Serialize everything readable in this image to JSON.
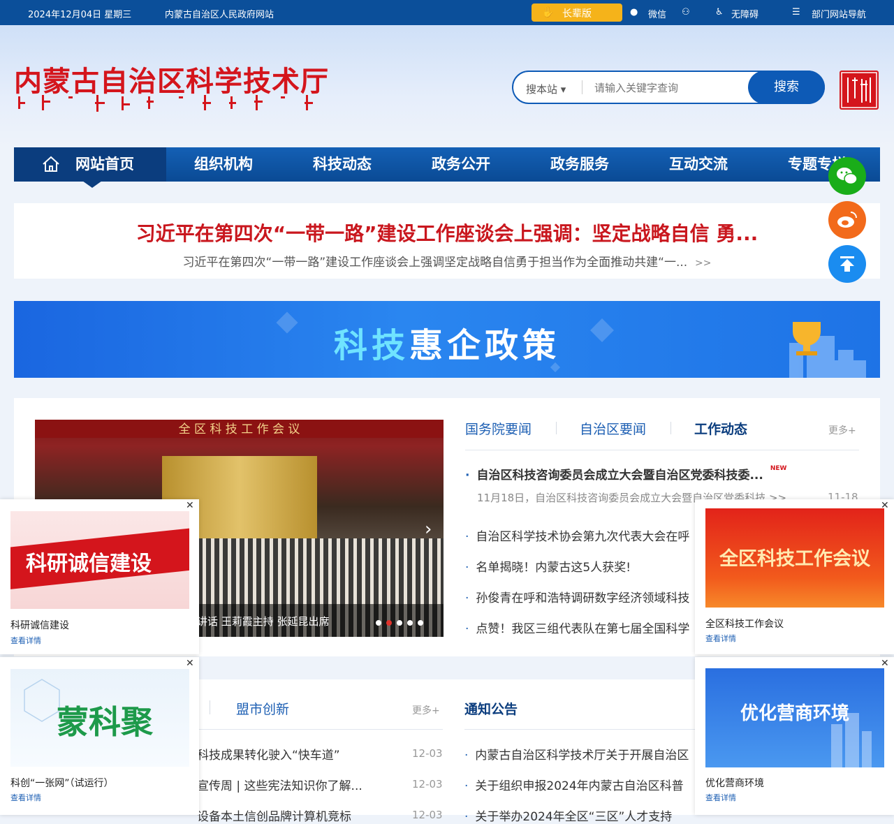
{
  "topbar": {
    "date": "2024年12月04日 星期三",
    "site": "内蒙古自治区人民政府网站",
    "elder": "长辈版",
    "wechat": "微信",
    "accessibility": "无障碍",
    "dept_nav": "部门网站导航"
  },
  "header": {
    "title": "内蒙古自治区科学技术厅",
    "search_scope": "搜本站",
    "search_placeholder": "请输入关键字查询",
    "search_button": "搜索"
  },
  "nav": {
    "items": [
      "网站首页",
      "组织机构",
      "科技动态",
      "政务公开",
      "政务服务",
      "互动交流",
      "专题专栏"
    ]
  },
  "headline": {
    "title": "习近平在第四次“一带一路”建设工作座谈会上强调：坚定战略自信 勇...",
    "summary": "习近平在第四次“一带一路”建设工作座谈会上强调坚定战略自信勇于担当作为全面推动共建“一...",
    "more": ">>"
  },
  "banner": {
    "part1": "科技",
    "part2": "惠企政策"
  },
  "news": {
    "photo_banner": "全 区 科 技 工 作 会 议",
    "photo_caption": "讲话 王莉霞主持 张延昆出席",
    "tabs": [
      "国务院要闻",
      "自治区要闻",
      "工作动态"
    ],
    "more": "更多+",
    "featured_title": "自治区科技咨询委员会成立大会暨自治区党委科技委...",
    "new_badge": "NEW",
    "featured_summary": "11月18日，自治区科技咨询委员会成立大会暨自治区党委科技",
    "featured_more": ">>",
    "featured_date": "11-18",
    "items": [
      "自治区科学技术协会第九次代表大会在呼",
      "名单揭晓！内蒙古这5人获奖!",
      "孙俊青在呼和浩特调研数字经济领域科技",
      "点赞！我区三组代表队在第七届全国科学"
    ]
  },
  "lower": {
    "left_tab": "盟市创新",
    "left_more": "更多+",
    "left_rows": [
      {
        "text": "科技成果转化驶入“快车道”",
        "date": "12-03"
      },
      {
        "text": "宣传周 | 这些宪法知识你了解...",
        "date": "12-03"
      },
      {
        "text": "设备本土信创品牌计算机竞标",
        "date": "12-03"
      }
    ],
    "right_tab": "通知公告",
    "right_rows": [
      "内蒙古自治区科学技术厅关于开展自治区",
      "关于组织申报2024年内蒙古自治区科普",
      "关于举办2024年全区“三区”人才支持"
    ]
  },
  "cards": [
    {
      "image_text": "科研诚信建设",
      "caption": "科研诚信建设",
      "link": "查看详情"
    },
    {
      "image_text": "全区科技工作会议",
      "caption": "全区科技工作会议",
      "link": "查看详情"
    },
    {
      "image_text": "蒙科聚",
      "caption": "科创“一张网”（试运行）",
      "link": "查看详情"
    },
    {
      "image_text": "优化营商环境",
      "caption": "优化营商环境",
      "link": "查看详情"
    }
  ],
  "colors": {
    "primary": "#0b4f9a",
    "accent_red": "#d4151c",
    "elder_yellow": "#f5b31a",
    "wechat_green": "#1aad19",
    "weibo_orange": "#f26a1b",
    "top_blue": "#1a8cf0"
  }
}
